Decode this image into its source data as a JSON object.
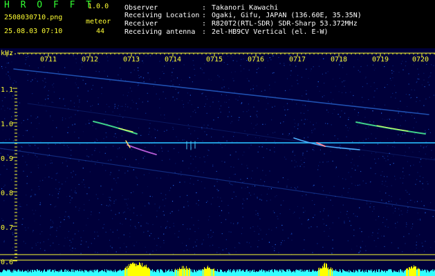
{
  "app": {
    "title_letters": "H R O F F T",
    "version": "1.0.0"
  },
  "file": {
    "name": "2508030710.png",
    "datetime": "25.08.03 07:10"
  },
  "stats": {
    "label": "meteor",
    "count": "44"
  },
  "info": [
    {
      "label": "Observer",
      "sep": ":",
      "value": "Takanori Kawachi"
    },
    {
      "label": "Receiving Location",
      "sep": ":",
      "value": "Ogaki, Gifu, JAPAN (136.60E, 35.35N)"
    },
    {
      "label": "Receiver",
      "sep": ":",
      "value": "R820T2(RTL-SDR) SDR-Sharp 53.372MHz"
    },
    {
      "label": "Receiving antenna",
      "sep": ":",
      "value": "2el-HB9CV Vertical (el. E-W)"
    }
  ],
  "axis": {
    "y_unit": "kHz",
    "time_ticks": [
      "0711",
      "0712",
      "0713",
      "0714",
      "0715",
      "0716",
      "0717",
      "0718",
      "0719",
      "0720"
    ],
    "freq_ticks": [
      "1.1",
      "1.0",
      "0.9",
      "0.8",
      "0.7",
      "0.6"
    ],
    "extra_freq_tick": "0.6"
  },
  "colors": {
    "background": "#00003a",
    "axis_yellow": "#ffff33",
    "info_white": "#ffffff",
    "title_green": "#33ff33",
    "power_cyan": "#33ffff",
    "power_yellow": "#ffff00"
  }
}
